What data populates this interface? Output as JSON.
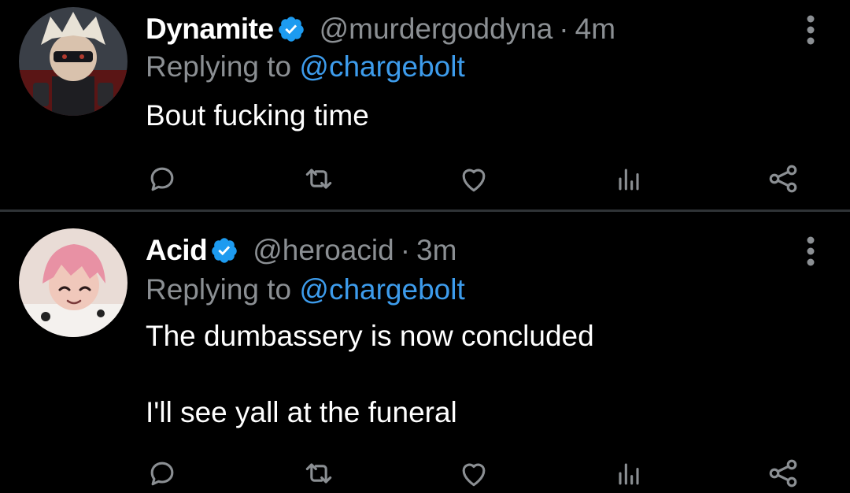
{
  "colors": {
    "background": "#000000",
    "primary_text": "#ffffff",
    "secondary_text": "#8b8f93",
    "link": "#3d9cec",
    "verified_badge": "#1d9bf0",
    "divider": "#2f3336",
    "icon": "#8b8f93"
  },
  "tweets": [
    {
      "display_name": "Dynamite",
      "handle": "@murdergoddyna",
      "separator": "·",
      "time": "4m",
      "verified": true,
      "avatar_icon": "avatar-dynamite",
      "reply_prefix": "Replying to",
      "reply_handle": "@chargebolt",
      "body_lines": [
        "Bout fucking time"
      ]
    },
    {
      "display_name": "Acid",
      "handle": "@heroacid",
      "separator": "·",
      "time": "3m",
      "verified": true,
      "avatar_icon": "avatar-acid",
      "reply_prefix": "Replying to",
      "reply_handle": "@chargebolt",
      "body_lines": [
        "The dumbassery is now concluded",
        "I'll see yall at the funeral"
      ]
    }
  ],
  "action_icons": [
    "reply-icon",
    "retweet-icon",
    "like-icon",
    "stats-icon",
    "share-icon"
  ]
}
